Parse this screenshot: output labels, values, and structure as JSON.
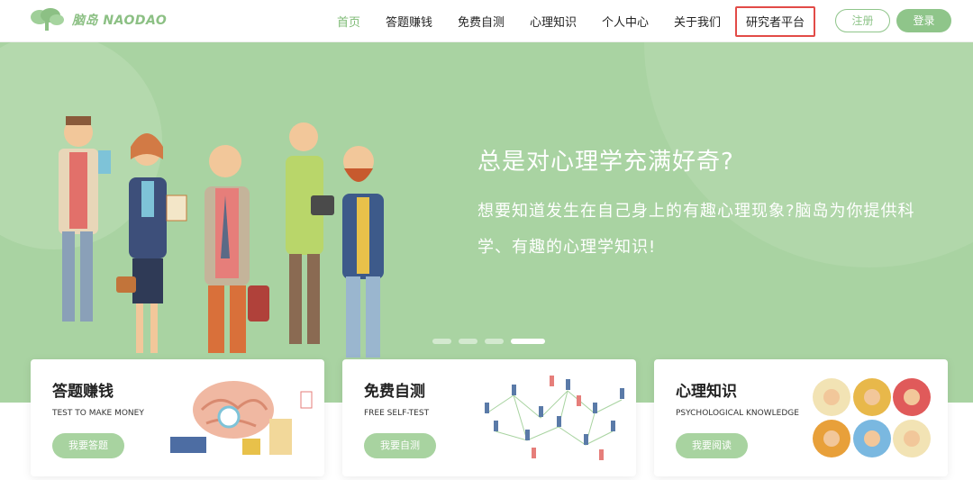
{
  "nav": {
    "logo_text": "脑岛 NAODAO",
    "items": [
      "首页",
      "答题赚钱",
      "免费自测",
      "心理知识",
      "个人中心",
      "关于我们",
      "研究者平台"
    ],
    "register_label": "注册",
    "login_label": "登录"
  },
  "hero": {
    "title": "总是对心理学充满好奇?",
    "description": "想要知道发生在自己身上的有趣心理现象?脑岛为你提供科学、有趣的心理学知识!",
    "slides_total": 4,
    "active_slide": 4
  },
  "cards": [
    {
      "title": "答题赚钱",
      "subtitle": "TEST TO MAKE MONEY",
      "button": "我要答题"
    },
    {
      "title": "免费自测",
      "subtitle": "FREE SELF-TEST",
      "button": "我要自测"
    },
    {
      "title": "心理知识",
      "subtitle": "PSYCHOLOGICAL KNOWLEDGE",
      "button": "我要阅读"
    }
  ],
  "colors": {
    "brand_green": "#8fc58a",
    "hero_bg": "#a9d3a2",
    "highlight_red": "#e24b47"
  }
}
